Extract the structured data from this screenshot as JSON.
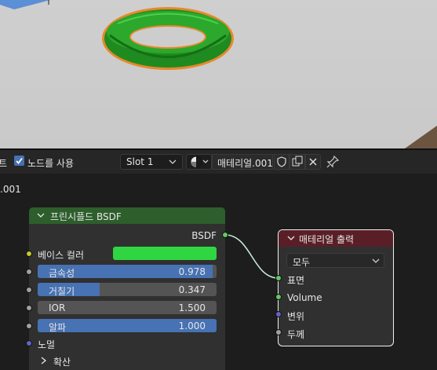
{
  "header": {
    "truncated_left": "트",
    "use_nodes_label": "노드를 사용",
    "slot_label": "Slot 1",
    "material_name": "매테리얼.001"
  },
  "editor": {
    "left_partial_label": ".001"
  },
  "bsdf_node": {
    "title": "프린시플드 BSDF",
    "output_label": "BSDF",
    "base_color_label": "베이스 컬러",
    "base_color": "#2fd642",
    "sliders": [
      {
        "label": "금속성",
        "value": "0.978",
        "fraction": 0.978
      },
      {
        "label": "거칠기",
        "value": "0.347",
        "fraction": 0.347
      },
      {
        "label": "IOR",
        "value": "1.500",
        "fraction": 0
      },
      {
        "label": "알파",
        "value": "1.000",
        "fraction": 1.0
      }
    ],
    "normal_label": "노멀",
    "diffuse_label": "확산"
  },
  "output_node": {
    "title": "매테리얼 출력",
    "target": "모두",
    "inputs": [
      "표면",
      "Volume",
      "변위",
      "두께"
    ]
  },
  "colors": {
    "accent": "#4772b3",
    "bsdf_header": "#2d5e2c",
    "output_header": "#5a1f26",
    "selected_outline": "#f0f0f0"
  }
}
